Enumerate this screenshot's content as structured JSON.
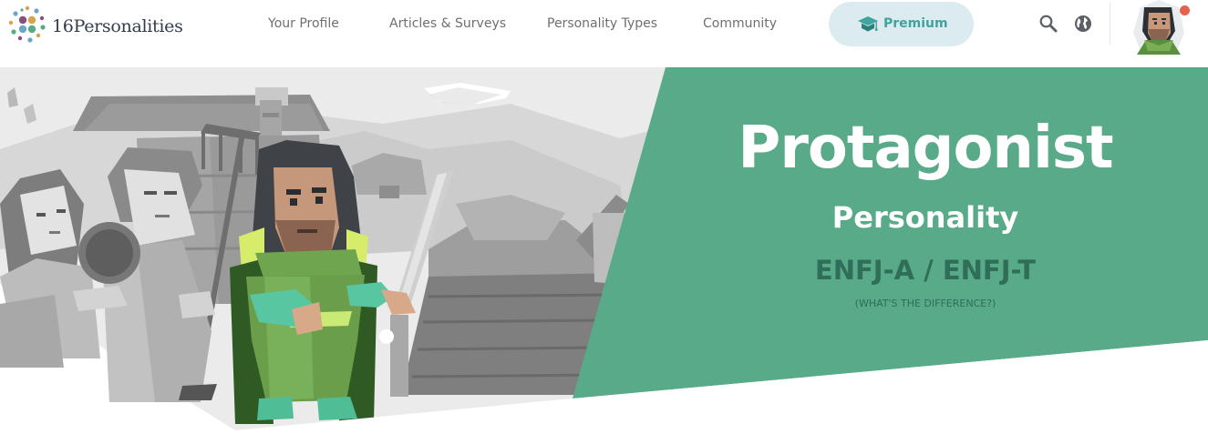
{
  "brand": {
    "name": "16Personalities"
  },
  "nav": {
    "items": [
      {
        "label": "Your Profile"
      },
      {
        "label": "Articles & Surveys"
      },
      {
        "label": "Personality Types"
      },
      {
        "label": "Community"
      }
    ],
    "premium_label": "Premium"
  },
  "header_icons": [
    "search-icon",
    "globe-icon",
    "user-avatar",
    "notification-dot"
  ],
  "hero": {
    "title": "Protagonist",
    "subtitle": "Personality",
    "type_codes": "ENFJ-A / ENFJ-T",
    "difference_link": "(WHAT'S THE DIFFERENCE?)"
  },
  "colors": {
    "hero_green": "#58aa88",
    "dark_green_text": "#2f6e58",
    "premium_bg": "#dcebef",
    "premium_text": "#3fa3a0",
    "notification": "#e5614b",
    "nav_text": "#6e6f73"
  }
}
